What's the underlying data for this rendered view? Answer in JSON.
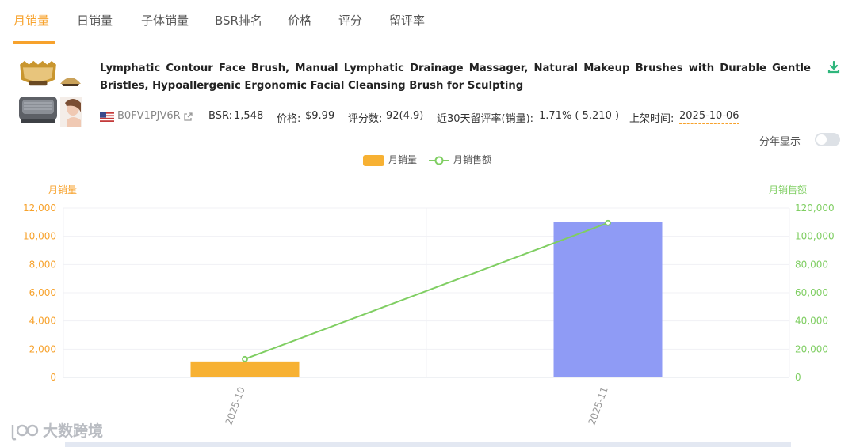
{
  "tabs": [
    "月销量",
    "日销量",
    "子体销量",
    "BSR排名",
    "价格",
    "评分",
    "留评率"
  ],
  "product": {
    "title": "Lymphatic Contour Face Brush, Manual Lymphatic Drainage Massager, Natural Makeup Brushes with Durable Gentle Bristles, Hypoallergenic Ergonomic Facial Cleansing Brush for Sculpting",
    "asin": "B0FV1PJV6R",
    "bsr_label": "BSR:",
    "bsr": "1,548",
    "price_label": "价格:",
    "price": "$9.99",
    "rating_label": "评分数:",
    "rating": "92(4.9)",
    "review_label": "近30天留评率(销量):",
    "review": "1.71% ( 5,210 )",
    "listed_label": "上架时间:",
    "listed": "2025-10-06"
  },
  "toggle_label": "分年显示",
  "watermark": "大数跨境",
  "colors": {
    "accent": "#f7a22c",
    "bar": "#f7b133",
    "bar_highlight": "#8f9bf5",
    "line": "#7fce62"
  },
  "chart_data": {
    "type": "bar",
    "categories": [
      "2025-10",
      "2025-11"
    ],
    "series": [
      {
        "name": "月销量",
        "type": "bar",
        "axis": "left",
        "values": [
          1130,
          11000
        ]
      },
      {
        "name": "月销售额",
        "type": "line",
        "axis": "right",
        "values": [
          13000,
          109500
        ]
      }
    ],
    "ylabel_left": "月销量",
    "ylabel_right": "月销售额",
    "ylim_left": [
      0,
      12000
    ],
    "ylim_right": [
      0,
      120000
    ],
    "yticks_left": [
      "0",
      "2,000",
      "4,000",
      "6,000",
      "8,000",
      "10,000",
      "12,000"
    ],
    "yticks_right": [
      "0",
      "20,000",
      "40,000",
      "60,000",
      "80,000",
      "100,000",
      "120,000"
    ],
    "highlighted_category": "2025-11",
    "legend_position": "top-center",
    "grid": true
  }
}
